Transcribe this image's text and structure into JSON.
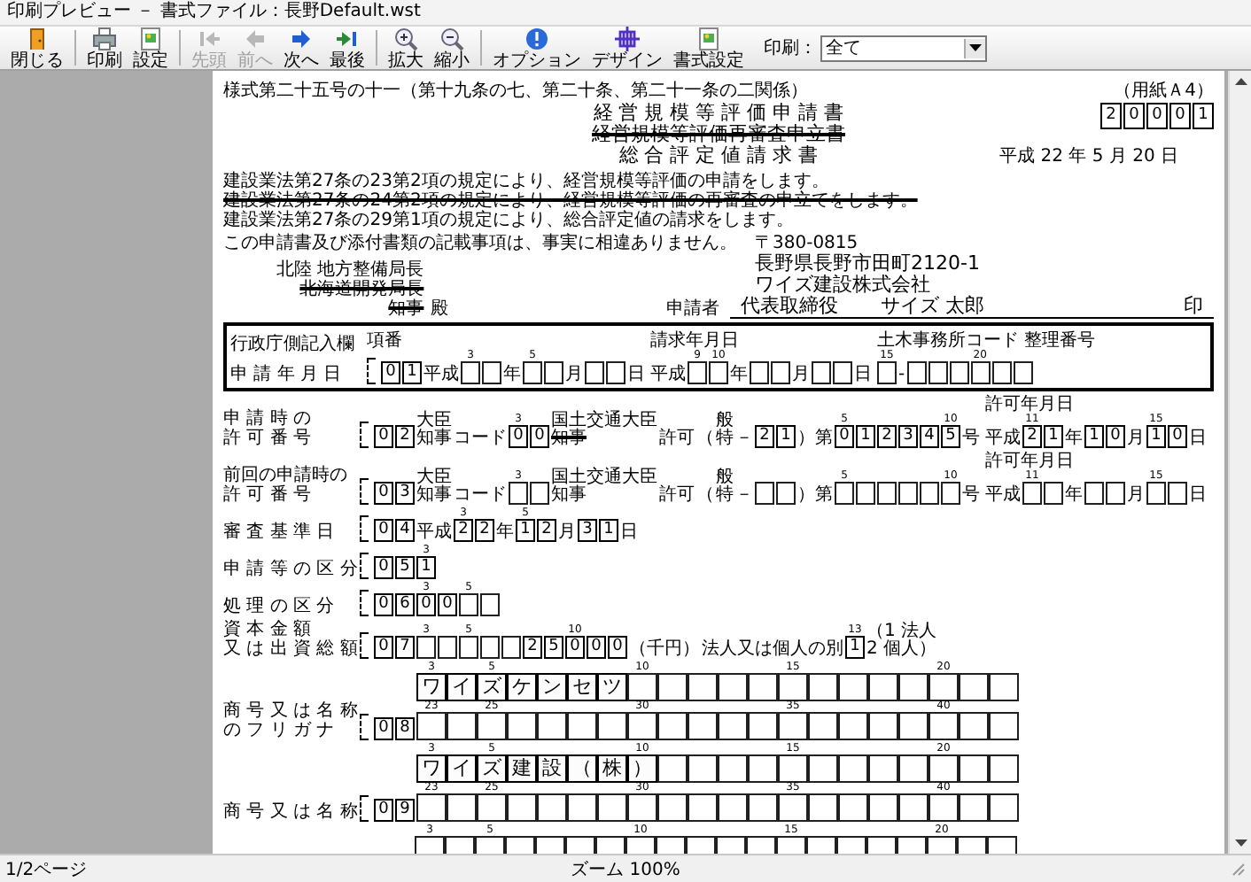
{
  "window": {
    "title": "印刷プレビュー － 書式ファイル：長野Default.wst"
  },
  "toolbar": {
    "items": [
      {
        "kind": "close",
        "label": "閉じる",
        "disabled": false,
        "separator_before": false
      },
      {
        "kind": "print",
        "label": "印刷",
        "disabled": false,
        "separator_before": true
      },
      {
        "kind": "setup",
        "label": "設定",
        "disabled": false,
        "separator_before": false
      },
      {
        "kind": "first",
        "label": "先頭",
        "disabled": true,
        "separator_before": true
      },
      {
        "kind": "prev",
        "label": "前へ",
        "disabled": true,
        "separator_before": false
      },
      {
        "kind": "next",
        "label": "次へ",
        "disabled": false,
        "separator_before": false
      },
      {
        "kind": "last",
        "label": "最後",
        "disabled": false,
        "separator_before": false
      },
      {
        "kind": "zoom_in",
        "label": "拡大",
        "disabled": false,
        "separator_before": true
      },
      {
        "kind": "zoom_out",
        "label": "縮小",
        "disabled": false,
        "separator_before": false
      },
      {
        "kind": "info",
        "label": "オプション",
        "disabled": false,
        "separator_before": true
      },
      {
        "kind": "design",
        "label": "デザイン",
        "disabled": false,
        "separator_before": false
      },
      {
        "kind": "format",
        "label": "書式設定",
        "disabled": false,
        "separator_before": false
      }
    ],
    "print_range": {
      "label": "印刷：",
      "value": "全て"
    }
  },
  "document": {
    "form_number": "様式第二十五号の十一（第十九条の七、第二十条、第二十一条の二関係）",
    "paper_size": "（用紙Ａ4）",
    "code_boxes": [
      "2",
      "0",
      "0",
      "0",
      "1"
    ],
    "titles": [
      {
        "text": "経 営 規 模 等 評 価 申 請 書",
        "struck": false
      },
      {
        "text": "経営規模等評価再審査申立書",
        "struck": true
      },
      {
        "text": "総 合 評 定 値 請 求 書",
        "struck": false
      }
    ],
    "date": "平成 22 年 5 月 20 日",
    "statements": [
      {
        "text": "建設業法第27条の23第2項の規定により、経営規模等評価の申請をします。",
        "struck": false
      },
      {
        "text": "建設業法第27条の24第2項の規定により、経営規模等評価の再審査の申立てをします。",
        "struck": true
      },
      {
        "text": "建設業法第27条の29第1項の規定により、総合評定値の請求をします。",
        "struck": false
      }
    ],
    "declaration": "この申請書及び添付書類の記載事項は、事実に相違ありません。",
    "addressee": {
      "lines": [
        {
          "text": "北陸 地方整備局長",
          "struck": false
        },
        {
          "text": "北海道開発局長",
          "struck": true
        },
        {
          "text": "知事",
          "struck": true
        }
      ],
      "suffix": "殿"
    },
    "applicant": {
      "postal": "〒380-0815",
      "address": "長野県長野市田町2120-1",
      "company": "ワイズ建設株式会社",
      "label": "申請者",
      "position": "代表取締役",
      "name": "サイズ 太郎",
      "seal": "印"
    },
    "admin_section": {
      "title": "行政庁側記入欄",
      "row": {
        "label": [
          "申 請 年 月 日"
        ],
        "no_caption": "項番",
        "no": [
          "0",
          "1"
        ],
        "parts": [
          {
            "kind": "text",
            "text": "平成"
          },
          {
            "kind": "boxes",
            "cells": [
              {
                "kind": "blank",
                "m": "3"
              },
              {
                "kind": "blank"
              }
            ]
          },
          {
            "kind": "text",
            "text": "年"
          },
          {
            "kind": "boxes",
            "cells": [
              {
                "kind": "blank",
                "m": "5"
              },
              {
                "kind": "blank"
              }
            ]
          },
          {
            "kind": "text",
            "text": "月"
          },
          {
            "kind": "boxes",
            "cells": [
              {
                "kind": "blank"
              },
              {
                "kind": "blank"
              }
            ]
          },
          {
            "kind": "text",
            "text": "日"
          },
          {
            "kind": "group",
            "caption": "請求年月日",
            "parts": [
              {
                "kind": "text",
                "text": "平成"
              },
              {
                "kind": "boxes",
                "cells": [
                  {
                    "kind": "blank",
                    "m": "9"
                  },
                  {
                    "kind": "blank",
                    "m": "10"
                  }
                ]
              },
              {
                "kind": "text",
                "text": "年"
              },
              {
                "kind": "boxes",
                "cells": [
                  {
                    "kind": "blank"
                  },
                  {
                    "kind": "blank"
                  }
                ]
              },
              {
                "kind": "text",
                "text": "月"
              },
              {
                "kind": "boxes",
                "cells": [
                  {
                    "kind": "blank"
                  },
                  {
                    "kind": "blank"
                  }
                ]
              },
              {
                "kind": "text",
                "text": "日"
              }
            ]
          },
          {
            "kind": "group",
            "caption": "土木事務所コード 整理番号",
            "parts": [
              {
                "kind": "boxes",
                "cells": [
                  {
                    "kind": "blank",
                    "m": "15"
                  }
                ]
              },
              {
                "kind": "text",
                "text": "-"
              },
              {
                "kind": "boxes",
                "cells": [
                  {
                    "kind": "blank"
                  },
                  {
                    "kind": "blank"
                  },
                  {
                    "kind": "blank"
                  },
                  {
                    "kind": "blank",
                    "m": "20"
                  },
                  {
                    "kind": "blank"
                  },
                  {
                    "kind": "blank"
                  }
                ]
              }
            ]
          }
        ]
      }
    },
    "rows": [
      {
        "label": [
          "申 請 時 の",
          "許 可 番 号"
        ],
        "no": [
          "0",
          "2"
        ],
        "parts": [
          {
            "kind": "stack",
            "lines": [
              {
                "text": "大臣",
                "struck": false
              },
              {
                "text": "知事",
                "struck": false
              }
            ]
          },
          {
            "kind": "text",
            "text": "コード"
          },
          {
            "kind": "boxes",
            "cells": [
              {
                "kind": "filled",
                "c": "0",
                "m": "3"
              },
              {
                "kind": "filled",
                "c": "0"
              }
            ]
          },
          {
            "kind": "stack",
            "lines": [
              {
                "text": "国土交通大臣",
                "struck": false
              },
              {
                "text": "知事",
                "struck": true
              }
            ]
          },
          {
            "kind": "text",
            "text": "許可"
          },
          {
            "kind": "text",
            "text": "（"
          },
          {
            "kind": "stack",
            "lines": [
              {
                "text": "般",
                "struck": false
              },
              {
                "text": "特",
                "struck": false
              }
            ]
          },
          {
            "kind": "text",
            "text": "－"
          },
          {
            "kind": "boxes",
            "cells": [
              {
                "kind": "filled",
                "c": "2"
              },
              {
                "kind": "filled",
                "c": "1"
              }
            ]
          },
          {
            "kind": "text",
            "text": "）第"
          },
          {
            "kind": "boxes",
            "cells": [
              {
                "kind": "filled",
                "c": "0",
                "m": "5"
              },
              {
                "kind": "filled",
                "c": "1"
              },
              {
                "kind": "filled",
                "c": "2"
              },
              {
                "kind": "filled",
                "c": "3"
              },
              {
                "kind": "filled",
                "c": "4"
              },
              {
                "kind": "filled",
                "c": "5",
                "m": "10"
              }
            ]
          },
          {
            "kind": "text",
            "text": "号"
          },
          {
            "kind": "group",
            "caption": "許可年月日",
            "parts": [
              {
                "kind": "text",
                "text": "平成"
              },
              {
                "kind": "boxes",
                "cells": [
                  {
                    "kind": "filled",
                    "c": "2",
                    "m": "11"
                  },
                  {
                    "kind": "filled",
                    "c": "1"
                  }
                ]
              },
              {
                "kind": "text",
                "text": "年"
              },
              {
                "kind": "boxes",
                "cells": [
                  {
                    "kind": "filled",
                    "c": "1"
                  },
                  {
                    "kind": "filled",
                    "c": "0"
                  }
                ]
              },
              {
                "kind": "text",
                "text": "月"
              },
              {
                "kind": "boxes",
                "cells": [
                  {
                    "kind": "filled",
                    "c": "1",
                    "m": "15"
                  },
                  {
                    "kind": "filled",
                    "c": "0"
                  }
                ]
              },
              {
                "kind": "text",
                "text": "日"
              }
            ]
          }
        ]
      },
      {
        "label": [
          "前回の申請時の",
          "許 可 番 号"
        ],
        "no": [
          "0",
          "3"
        ],
        "parts": [
          {
            "kind": "stack",
            "lines": [
              {
                "text": "大臣",
                "struck": false
              },
              {
                "text": "知事",
                "struck": false
              }
            ]
          },
          {
            "kind": "text",
            "text": "コード"
          },
          {
            "kind": "boxes",
            "cells": [
              {
                "kind": "blank",
                "m": "3"
              },
              {
                "kind": "blank"
              }
            ]
          },
          {
            "kind": "stack",
            "lines": [
              {
                "text": "国土交通大臣",
                "struck": false
              },
              {
                "text": "知事",
                "struck": false
              }
            ]
          },
          {
            "kind": "text",
            "text": "許可"
          },
          {
            "kind": "text",
            "text": "（"
          },
          {
            "kind": "stack",
            "lines": [
              {
                "text": "般",
                "struck": false
              },
              {
                "text": "特",
                "struck": false
              }
            ]
          },
          {
            "kind": "text",
            "text": "－"
          },
          {
            "kind": "boxes",
            "cells": [
              {
                "kind": "blank"
              },
              {
                "kind": "blank"
              }
            ]
          },
          {
            "kind": "text",
            "text": "）第"
          },
          {
            "kind": "boxes",
            "cells": [
              {
                "kind": "blank",
                "m": "5"
              },
              {
                "kind": "blank"
              },
              {
                "kind": "blank"
              },
              {
                "kind": "blank"
              },
              {
                "kind": "blank"
              },
              {
                "kind": "blank",
                "m": "10"
              }
            ]
          },
          {
            "kind": "text",
            "text": "号"
          },
          {
            "kind": "group",
            "caption": "許可年月日",
            "parts": [
              {
                "kind": "text",
                "text": "平成"
              },
              {
                "kind": "boxes",
                "cells": [
                  {
                    "kind": "blank",
                    "m": "11"
                  },
                  {
                    "kind": "blank"
                  }
                ]
              },
              {
                "kind": "text",
                "text": "年"
              },
              {
                "kind": "boxes",
                "cells": [
                  {
                    "kind": "blank"
                  },
                  {
                    "kind": "blank"
                  }
                ]
              },
              {
                "kind": "text",
                "text": "月"
              },
              {
                "kind": "boxes",
                "cells": [
                  {
                    "kind": "blank",
                    "m": "15"
                  },
                  {
                    "kind": "blank"
                  }
                ]
              },
              {
                "kind": "text",
                "text": "日"
              }
            ]
          }
        ]
      },
      {
        "label": [
          "審 査 基 準 日"
        ],
        "no": [
          "0",
          "4"
        ],
        "parts": [
          {
            "kind": "text",
            "text": "平成"
          },
          {
            "kind": "boxes",
            "cells": [
              {
                "kind": "filled",
                "c": "2",
                "m": "3"
              },
              {
                "kind": "filled",
                "c": "2"
              }
            ]
          },
          {
            "kind": "text",
            "text": "年"
          },
          {
            "kind": "boxes",
            "cells": [
              {
                "kind": "filled",
                "c": "1",
                "m": "5"
              },
              {
                "kind": "filled",
                "c": "2"
              }
            ]
          },
          {
            "kind": "text",
            "text": "月"
          },
          {
            "kind": "boxes",
            "cells": [
              {
                "kind": "filled",
                "c": "3"
              },
              {
                "kind": "filled",
                "c": "1"
              }
            ]
          },
          {
            "kind": "text",
            "text": "日"
          }
        ]
      },
      {
        "label": [
          "申 請 等 の 区 分"
        ],
        "no": [
          "0",
          "5"
        ],
        "parts": [
          {
            "kind": "boxes",
            "cells": [
              {
                "kind": "filled",
                "c": "1",
                "m": "3"
              }
            ]
          }
        ]
      },
      {
        "label": [
          "処 理 の 区 分"
        ],
        "no": [
          "0",
          "6"
        ],
        "parts": [
          {
            "kind": "boxes",
            "cells": [
              {
                "kind": "filled",
                "c": "0",
                "m": "3"
              },
              {
                "kind": "filled",
                "c": "0"
              }
            ]
          },
          {
            "kind": "boxes",
            "cells": [
              {
                "kind": "blank",
                "m": "5"
              },
              {
                "kind": "blank"
              }
            ]
          }
        ]
      },
      {
        "label": [
          "資 本 金 額",
          "又 は 出 資 総 額"
        ],
        "no": [
          "0",
          "7"
        ],
        "parts": [
          {
            "kind": "boxes",
            "cells": [
              {
                "kind": "blank",
                "m": "3"
              },
              {
                "kind": "blank"
              },
              {
                "kind": "blank",
                "m": "5"
              },
              {
                "kind": "blank"
              },
              {
                "kind": "blank"
              },
              {
                "kind": "filled",
                "c": "2"
              },
              {
                "kind": "filled",
                "c": "5"
              },
              {
                "kind": "filled",
                "c": "0",
                "m": "10"
              },
              {
                "kind": "filled",
                "c": "0"
              },
              {
                "kind": "filled",
                "c": "0"
              }
            ]
          },
          {
            "kind": "text",
            "text": "（千円）"
          },
          {
            "kind": "text",
            "text": "法人又は個人の別"
          },
          {
            "kind": "boxes",
            "cells": [
              {
                "kind": "filled",
                "c": "1",
                "m": "13"
              }
            ]
          },
          {
            "kind": "stack",
            "lines": [
              {
                "text": "（1 法人",
                "struck": false
              },
              {
                "text": "2 個人）",
                "struck": false
              }
            ]
          }
        ]
      },
      {
        "label": [
          "商 号 又 は 名 称",
          "の フ リ ガ ナ"
        ],
        "no": [
          "0",
          "8"
        ],
        "parts": [
          {
            "kind": "grid",
            "lines": [
              [
                {
                  "kind": "filled",
                  "c": "ワ",
                  "m": "3"
                },
                {
                  "kind": "filled",
                  "c": "イ"
                },
                {
                  "kind": "filled",
                  "c": "ズ",
                  "m": "5"
                },
                {
                  "kind": "filled",
                  "c": "ケ"
                },
                {
                  "kind": "filled",
                  "c": "ン"
                },
                {
                  "kind": "filled",
                  "c": "セ"
                },
                {
                  "kind": "filled",
                  "c": "ツ"
                },
                {
                  "kind": "blank",
                  "m": "10"
                },
                {
                  "kind": "blank"
                },
                {
                  "kind": "blank"
                },
                {
                  "kind": "blank"
                },
                {
                  "kind": "blank"
                },
                {
                  "kind": "blank",
                  "m": "15"
                },
                {
                  "kind": "blank"
                },
                {
                  "kind": "blank"
                },
                {
                  "kind": "blank"
                },
                {
                  "kind": "blank"
                },
                {
                  "kind": "blank",
                  "m": "20"
                },
                {
                  "kind": "blank"
                },
                {
                  "kind": "blank"
                }
              ],
              [
                {
                  "kind": "blank",
                  "m": "23"
                },
                {
                  "kind": "blank"
                },
                {
                  "kind": "blank",
                  "m": "25"
                },
                {
                  "kind": "blank"
                },
                {
                  "kind": "blank"
                },
                {
                  "kind": "blank"
                },
                {
                  "kind": "blank"
                },
                {
                  "kind": "blank",
                  "m": "30"
                },
                {
                  "kind": "blank"
                },
                {
                  "kind": "blank"
                },
                {
                  "kind": "blank"
                },
                {
                  "kind": "blank"
                },
                {
                  "kind": "blank",
                  "m": "35"
                },
                {
                  "kind": "blank"
                },
                {
                  "kind": "blank"
                },
                {
                  "kind": "blank"
                },
                {
                  "kind": "blank"
                },
                {
                  "kind": "blank",
                  "m": "40"
                },
                {
                  "kind": "blank"
                },
                {
                  "kind": "blank"
                }
              ]
            ]
          }
        ]
      },
      {
        "label": [
          "商 号 又 は 名 称"
        ],
        "no": [
          "0",
          "9"
        ],
        "parts": [
          {
            "kind": "grid",
            "lines": [
              [
                {
                  "kind": "filled",
                  "c": "ワ",
                  "m": "3"
                },
                {
                  "kind": "filled",
                  "c": "イ"
                },
                {
                  "kind": "filled",
                  "c": "ズ",
                  "m": "5"
                },
                {
                  "kind": "filled",
                  "c": "建"
                },
                {
                  "kind": "filled",
                  "c": "設"
                },
                {
                  "kind": "filled",
                  "c": "（"
                },
                {
                  "kind": "filled",
                  "c": "株"
                },
                {
                  "kind": "filled",
                  "c": "）",
                  "m": "10"
                },
                {
                  "kind": "blank"
                },
                {
                  "kind": "blank"
                },
                {
                  "kind": "blank"
                },
                {
                  "kind": "blank"
                },
                {
                  "kind": "blank",
                  "m": "15"
                },
                {
                  "kind": "blank"
                },
                {
                  "kind": "blank"
                },
                {
                  "kind": "blank"
                },
                {
                  "kind": "blank"
                },
                {
                  "kind": "blank",
                  "m": "20"
                },
                {
                  "kind": "blank"
                },
                {
                  "kind": "blank"
                }
              ],
              [
                {
                  "kind": "blank",
                  "m": "23"
                },
                {
                  "kind": "blank"
                },
                {
                  "kind": "blank",
                  "m": "25"
                },
                {
                  "kind": "blank"
                },
                {
                  "kind": "blank"
                },
                {
                  "kind": "blank"
                },
                {
                  "kind": "blank"
                },
                {
                  "kind": "blank",
                  "m": "30"
                },
                {
                  "kind": "blank"
                },
                {
                  "kind": "blank"
                },
                {
                  "kind": "blank"
                },
                {
                  "kind": "blank"
                },
                {
                  "kind": "blank",
                  "m": "35"
                },
                {
                  "kind": "blank"
                },
                {
                  "kind": "blank"
                },
                {
                  "kind": "blank"
                },
                {
                  "kind": "blank"
                },
                {
                  "kind": "blank",
                  "m": "40"
                },
                {
                  "kind": "blank"
                },
                {
                  "kind": "blank"
                }
              ]
            ]
          }
        ]
      },
      {
        "parts": [
          {
            "kind": "grid",
            "lines": [
              [
                {
                  "kind": "blank",
                  "m": "3"
                },
                {
                  "kind": "blank"
                },
                {
                  "kind": "blank",
                  "m": "5"
                },
                {
                  "kind": "blank"
                },
                {
                  "kind": "blank"
                },
                {
                  "kind": "blank"
                },
                {
                  "kind": "blank"
                },
                {
                  "kind": "blank",
                  "m": "10"
                },
                {
                  "kind": "blank"
                },
                {
                  "kind": "blank"
                },
                {
                  "kind": "blank"
                },
                {
                  "kind": "blank"
                },
                {
                  "kind": "blank",
                  "m": "15"
                },
                {
                  "kind": "blank"
                },
                {
                  "kind": "blank"
                },
                {
                  "kind": "blank"
                },
                {
                  "kind": "blank"
                },
                {
                  "kind": "blank",
                  "m": "20"
                },
                {
                  "kind": "blank"
                },
                {
                  "kind": "blank"
                }
              ]
            ]
          }
        ]
      }
    ]
  },
  "status_bar": {
    "page": "1/2ページ",
    "zoom": "ズーム 100%"
  }
}
